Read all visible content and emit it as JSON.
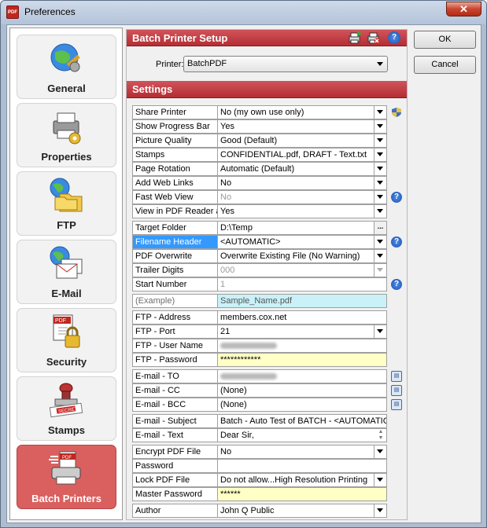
{
  "window": {
    "title": "Preferences",
    "close_label": "✕",
    "icon_text": "PDF"
  },
  "sidebar": {
    "items": [
      {
        "label": "General",
        "icon": "globe-tools-icon",
        "active": false
      },
      {
        "label": "Properties",
        "icon": "printer-gear-icon",
        "active": false
      },
      {
        "label": "FTP",
        "icon": "globe-folder-icon",
        "active": false
      },
      {
        "label": "E-Mail",
        "icon": "globe-mail-icon",
        "active": false
      },
      {
        "label": "Security",
        "icon": "pdf-lock-icon",
        "active": false
      },
      {
        "label": "Stamps",
        "icon": "secret-stamp-icon",
        "active": false
      },
      {
        "label": "Batch Printers",
        "icon": "pdf-printer-icon",
        "active": true
      }
    ]
  },
  "setup": {
    "title": "Batch Printer Setup",
    "printer_label": "Printer:",
    "printer_value": "BatchPDF"
  },
  "settings": {
    "title": "Settings",
    "rows": [
      {
        "label": "Share Printer",
        "value": "No (my own use only)",
        "ctrl": "dd",
        "side": "shield-icon"
      },
      {
        "label": "Show Progress Bar",
        "value": "Yes",
        "ctrl": "dd"
      },
      {
        "label": "Picture Quality",
        "value": "Good (Default)",
        "ctrl": "dd"
      },
      {
        "label": "Stamps",
        "value": "CONFIDENTIAL.pdf, DRAFT - Text.txt",
        "ctrl": "dd"
      },
      {
        "label": "Page Rotation",
        "value": "Automatic (Default)",
        "ctrl": "dd"
      },
      {
        "label": "Add Web Links",
        "value": "No",
        "ctrl": "dd"
      },
      {
        "label": "Fast Web View",
        "value": "No",
        "ctrl": "dd",
        "disabled": true,
        "side": "help-icon"
      },
      {
        "label": "View in PDF Reader after",
        "value": "Yes",
        "ctrl": "dd",
        "gap_after": true
      },
      {
        "label": "Target Folder",
        "value": "D:\\Temp",
        "ctrl": "ellipsis"
      },
      {
        "label": "Filename Header",
        "value": "<AUTOMATIC>",
        "ctrl": "dd",
        "selected": true,
        "side": "help-icon"
      },
      {
        "label": "PDF Overwrite",
        "value": "Overwrite Existing File (No Warning)",
        "ctrl": "dd"
      },
      {
        "label": "Trailer Digits",
        "value": "000",
        "ctrl": "dd",
        "disabled": true,
        "disabled_button": true
      },
      {
        "label": "Start Number",
        "value": "1",
        "ctrl": "none",
        "disabled": true,
        "side": "help-icon",
        "gap_after": true
      },
      {
        "label": "(Example)",
        "value": "Sample_Name.pdf",
        "ctrl": "none",
        "label_dim": true,
        "style": "cyan",
        "gap_after": true
      },
      {
        "label": "FTP - Address",
        "value": "members.cox.net",
        "ctrl": "none"
      },
      {
        "label": "FTP - Port",
        "value": "21",
        "ctrl": "dd"
      },
      {
        "label": "FTP - User Name",
        "value": "",
        "ctrl": "none",
        "blurred": true
      },
      {
        "label": "FTP - Password",
        "value": "************",
        "ctrl": "none",
        "style": "yellow",
        "gap_after": true
      },
      {
        "label": "E-mail - TO",
        "value": "",
        "ctrl": "none",
        "blurred": true,
        "side": "address-book-icon"
      },
      {
        "label": "E-mail - CC",
        "value": "(None)",
        "ctrl": "none",
        "side": "address-book-icon"
      },
      {
        "label": "E-mail - BCC",
        "value": "(None)",
        "ctrl": "none",
        "side": "address-book-icon",
        "gap_after": true
      },
      {
        "label": "E-mail - Subject",
        "value": "Batch - Auto Test of BATCH - <AUTOMATIC",
        "ctrl": "none"
      },
      {
        "label": "E-mail - Text",
        "value": "Dear Sir,",
        "ctrl": "spin",
        "gap_after": true
      },
      {
        "label": "Encrypt PDF File",
        "value": "No",
        "ctrl": "dd"
      },
      {
        "label": "Password",
        "value": "",
        "ctrl": "none"
      },
      {
        "label": "Lock PDF File",
        "value": "Do not allow...High Resolution Printing",
        "ctrl": "dd"
      },
      {
        "label": "Master Password",
        "value": "******",
        "ctrl": "none",
        "style": "yellow",
        "gap_after": true
      },
      {
        "label": "Author",
        "value": "John Q Public",
        "ctrl": "dd"
      }
    ]
  },
  "buttons": {
    "ok": "OK",
    "cancel": "Cancel"
  },
  "colors": {
    "accent_red": "#c0393f",
    "active_nav": "#d9605f",
    "selection": "#3399ff",
    "password_bg": "#ffffc6",
    "example_bg": "#c9f2f8"
  }
}
